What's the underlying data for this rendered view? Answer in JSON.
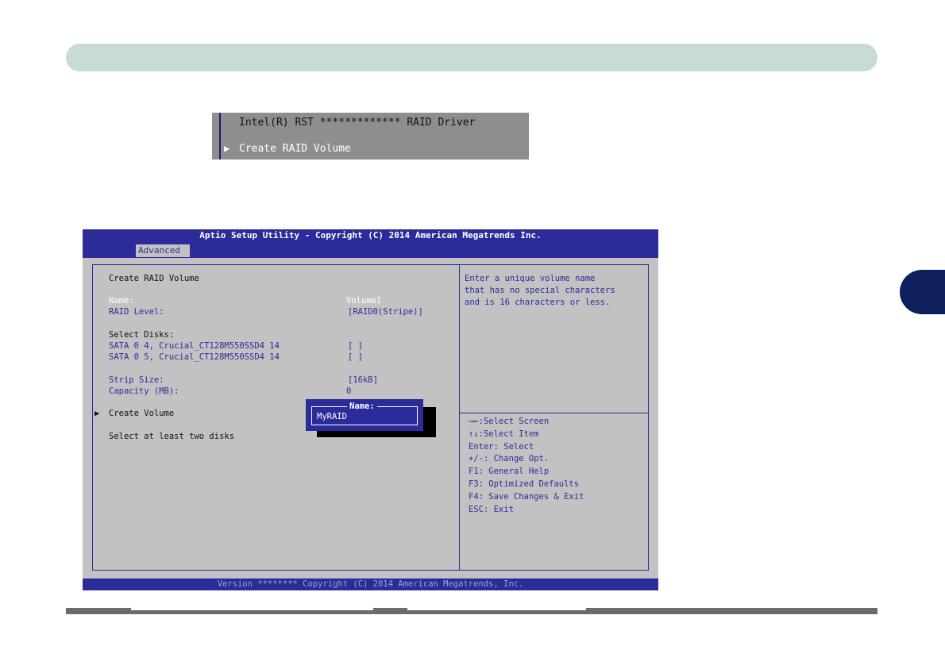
{
  "snapshot": {
    "driver_line": "Intel(R) RST ************* RAID Driver",
    "menu_arrow": "▶",
    "menu_item": "Create RAID Volume"
  },
  "bios": {
    "title": "Aptio Setup Utility - Copyright (C) 2014 American Megatrends Inc.",
    "tab": "Advanced",
    "heading": "Create RAID Volume",
    "name_label": "Name:",
    "name_value": "Volume1",
    "raid_level_label": "RAID Level:",
    "raid_level_value": "[RAID0(Stripe)]",
    "select_disks_label": "Select Disks:",
    "disks": [
      {
        "label": "SATA 0 4, Crucial_CT128M550SSD4 14",
        "value": "[ ]"
      },
      {
        "label": "SATA 0 5, Crucial_CT128M550SSD4 14",
        "value": "[ ]"
      }
    ],
    "strip_size_label": "Strip Size:",
    "strip_size_value": "[16kB]",
    "capacity_label": "Capacity (MB):",
    "capacity_value": "0",
    "create_arrow": "▶",
    "create_volume": "Create Volume",
    "hint": "Select at least two disks",
    "help_text": [
      "Enter a unique volume name",
      "that has no special characters",
      "and is 16 characters or less."
    ],
    "keys": [
      "→←:Select Screen",
      "↑↓:Select Item",
      "Enter: Select",
      "+/-: Change Opt.",
      "F1: General Help",
      "F3: Optimized Defaults",
      "F4: Save Changes & Exit",
      "ESC: Exit"
    ],
    "popup": {
      "label": "Name:",
      "value": "MyRAID"
    },
    "version": "Version ******** Copyright (C) 2014 American Megatrends, Inc."
  },
  "colors": {
    "bios_blue": "#2b2c9a",
    "bios_gray": "#c2c2c2",
    "header_bar": "#c7dcd6",
    "chapter_tab": "#0d1f5c"
  }
}
